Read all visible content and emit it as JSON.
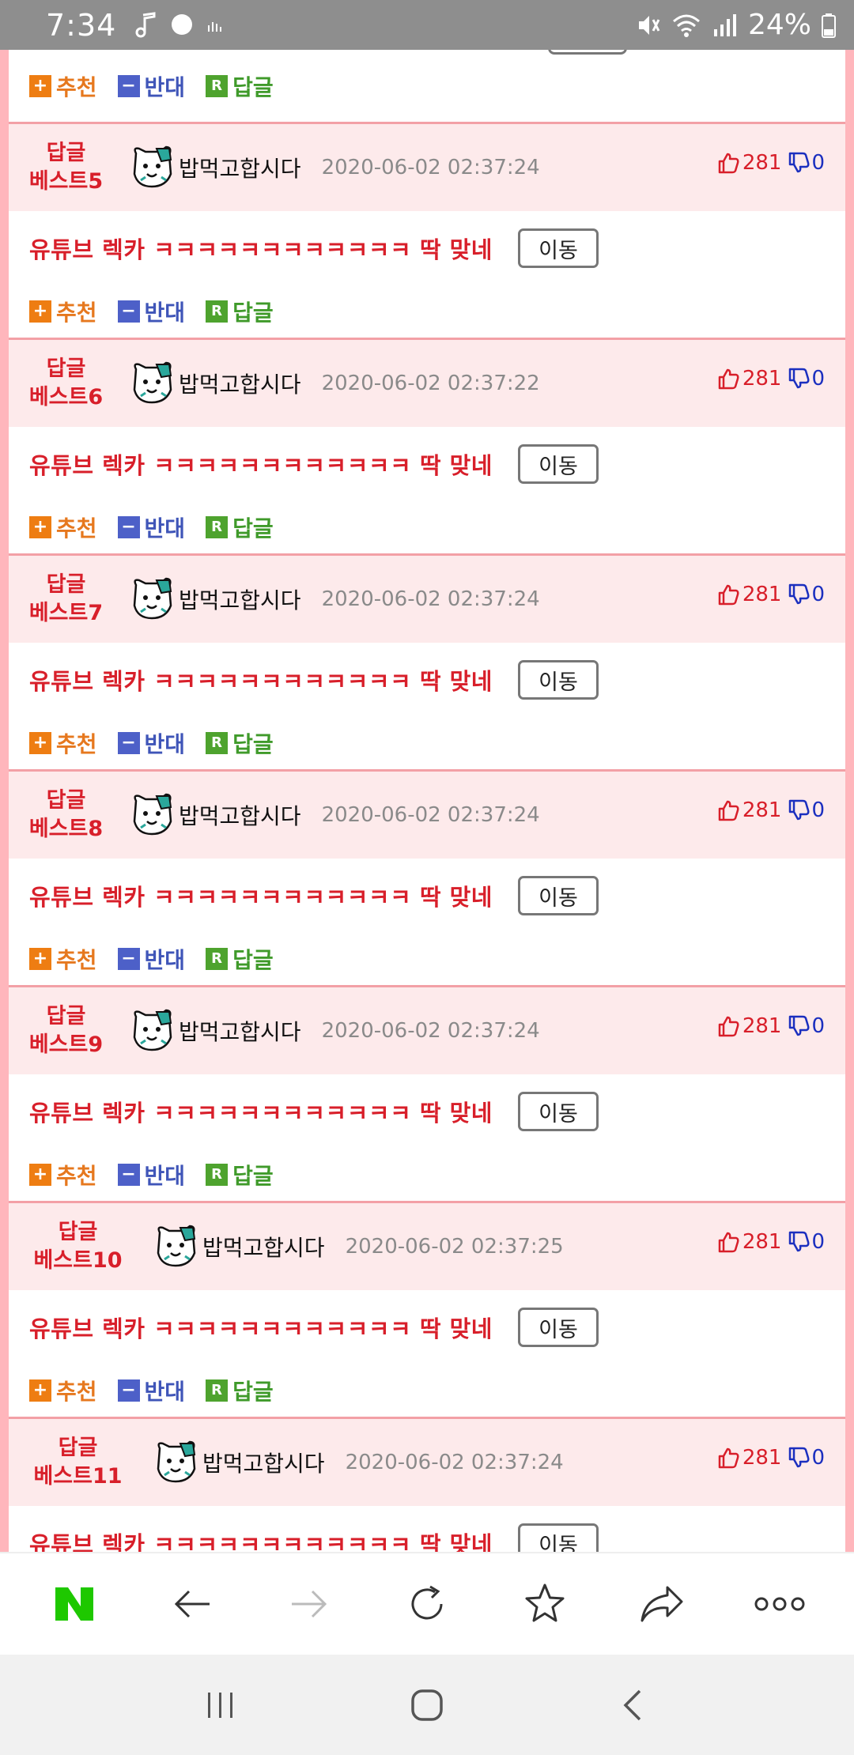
{
  "status": {
    "time": "7:34",
    "battery": "24%"
  },
  "actions": {
    "recommend": "추천",
    "oppose": "반대",
    "reply": "답글",
    "reply_badge": "R"
  },
  "move_label": "이동",
  "comments": [
    {
      "best_top": "답글",
      "best_bottom": "베스트5",
      "author": "밥먹고합시다",
      "date": "2020-06-02 02:37:24",
      "likes": "281",
      "dislikes": "0",
      "text": "유튜브 렉카 ㅋㅋㅋㅋㅋㅋㅋㅋㅋㅋㅋㅋ 딱 맞네"
    },
    {
      "best_top": "답글",
      "best_bottom": "베스트6",
      "author": "밥먹고합시다",
      "date": "2020-06-02 02:37:22",
      "likes": "281",
      "dislikes": "0",
      "text": "유튜브 렉카 ㅋㅋㅋㅋㅋㅋㅋㅋㅋㅋㅋㅋ 딱 맞네"
    },
    {
      "best_top": "답글",
      "best_bottom": "베스트7",
      "author": "밥먹고합시다",
      "date": "2020-06-02 02:37:24",
      "likes": "281",
      "dislikes": "0",
      "text": "유튜브 렉카 ㅋㅋㅋㅋㅋㅋㅋㅋㅋㅋㅋㅋ 딱 맞네"
    },
    {
      "best_top": "답글",
      "best_bottom": "베스트8",
      "author": "밥먹고합시다",
      "date": "2020-06-02 02:37:24",
      "likes": "281",
      "dislikes": "0",
      "text": "유튜브 렉카 ㅋㅋㅋㅋㅋㅋㅋㅋㅋㅋㅋㅋ 딱 맞네"
    },
    {
      "best_top": "답글",
      "best_bottom": "베스트9",
      "author": "밥먹고합시다",
      "date": "2020-06-02 02:37:24",
      "likes": "281",
      "dislikes": "0",
      "text": "유튜브 렉카 ㅋㅋㅋㅋㅋㅋㅋㅋㅋㅋㅋㅋ 딱 맞네"
    },
    {
      "best_top": "답글",
      "best_bottom": "베스트10",
      "author": "밥먹고합시다",
      "date": "2020-06-02 02:37:25",
      "likes": "281",
      "dislikes": "0",
      "text": "유튜브 렉카 ㅋㅋㅋㅋㅋㅋㅋㅋㅋㅋㅋㅋ 딱 맞네"
    },
    {
      "best_top": "답글",
      "best_bottom": "베스트11",
      "author": "밥먹고합시다",
      "date": "2020-06-02 02:37:24",
      "likes": "281",
      "dislikes": "0",
      "text": "유튜브 렉카 ㅋㅋㅋㅋㅋㅋㅋㅋㅋㅋㅋㅋ 딱 맞네"
    }
  ],
  "toolbar_icons": [
    "naver-logo-icon",
    "back-arrow-icon",
    "forward-arrow-icon",
    "refresh-icon",
    "bookmark-star-icon",
    "share-icon",
    "more-options-icon"
  ],
  "colors": {
    "best": "#d81f2a",
    "header_bg": "#fdeaeb",
    "border": "#f3a0a6",
    "recommend": "#ee7d12",
    "oppose": "#4d60c8",
    "reply": "#4ea32e",
    "naver": "#1ec800"
  }
}
